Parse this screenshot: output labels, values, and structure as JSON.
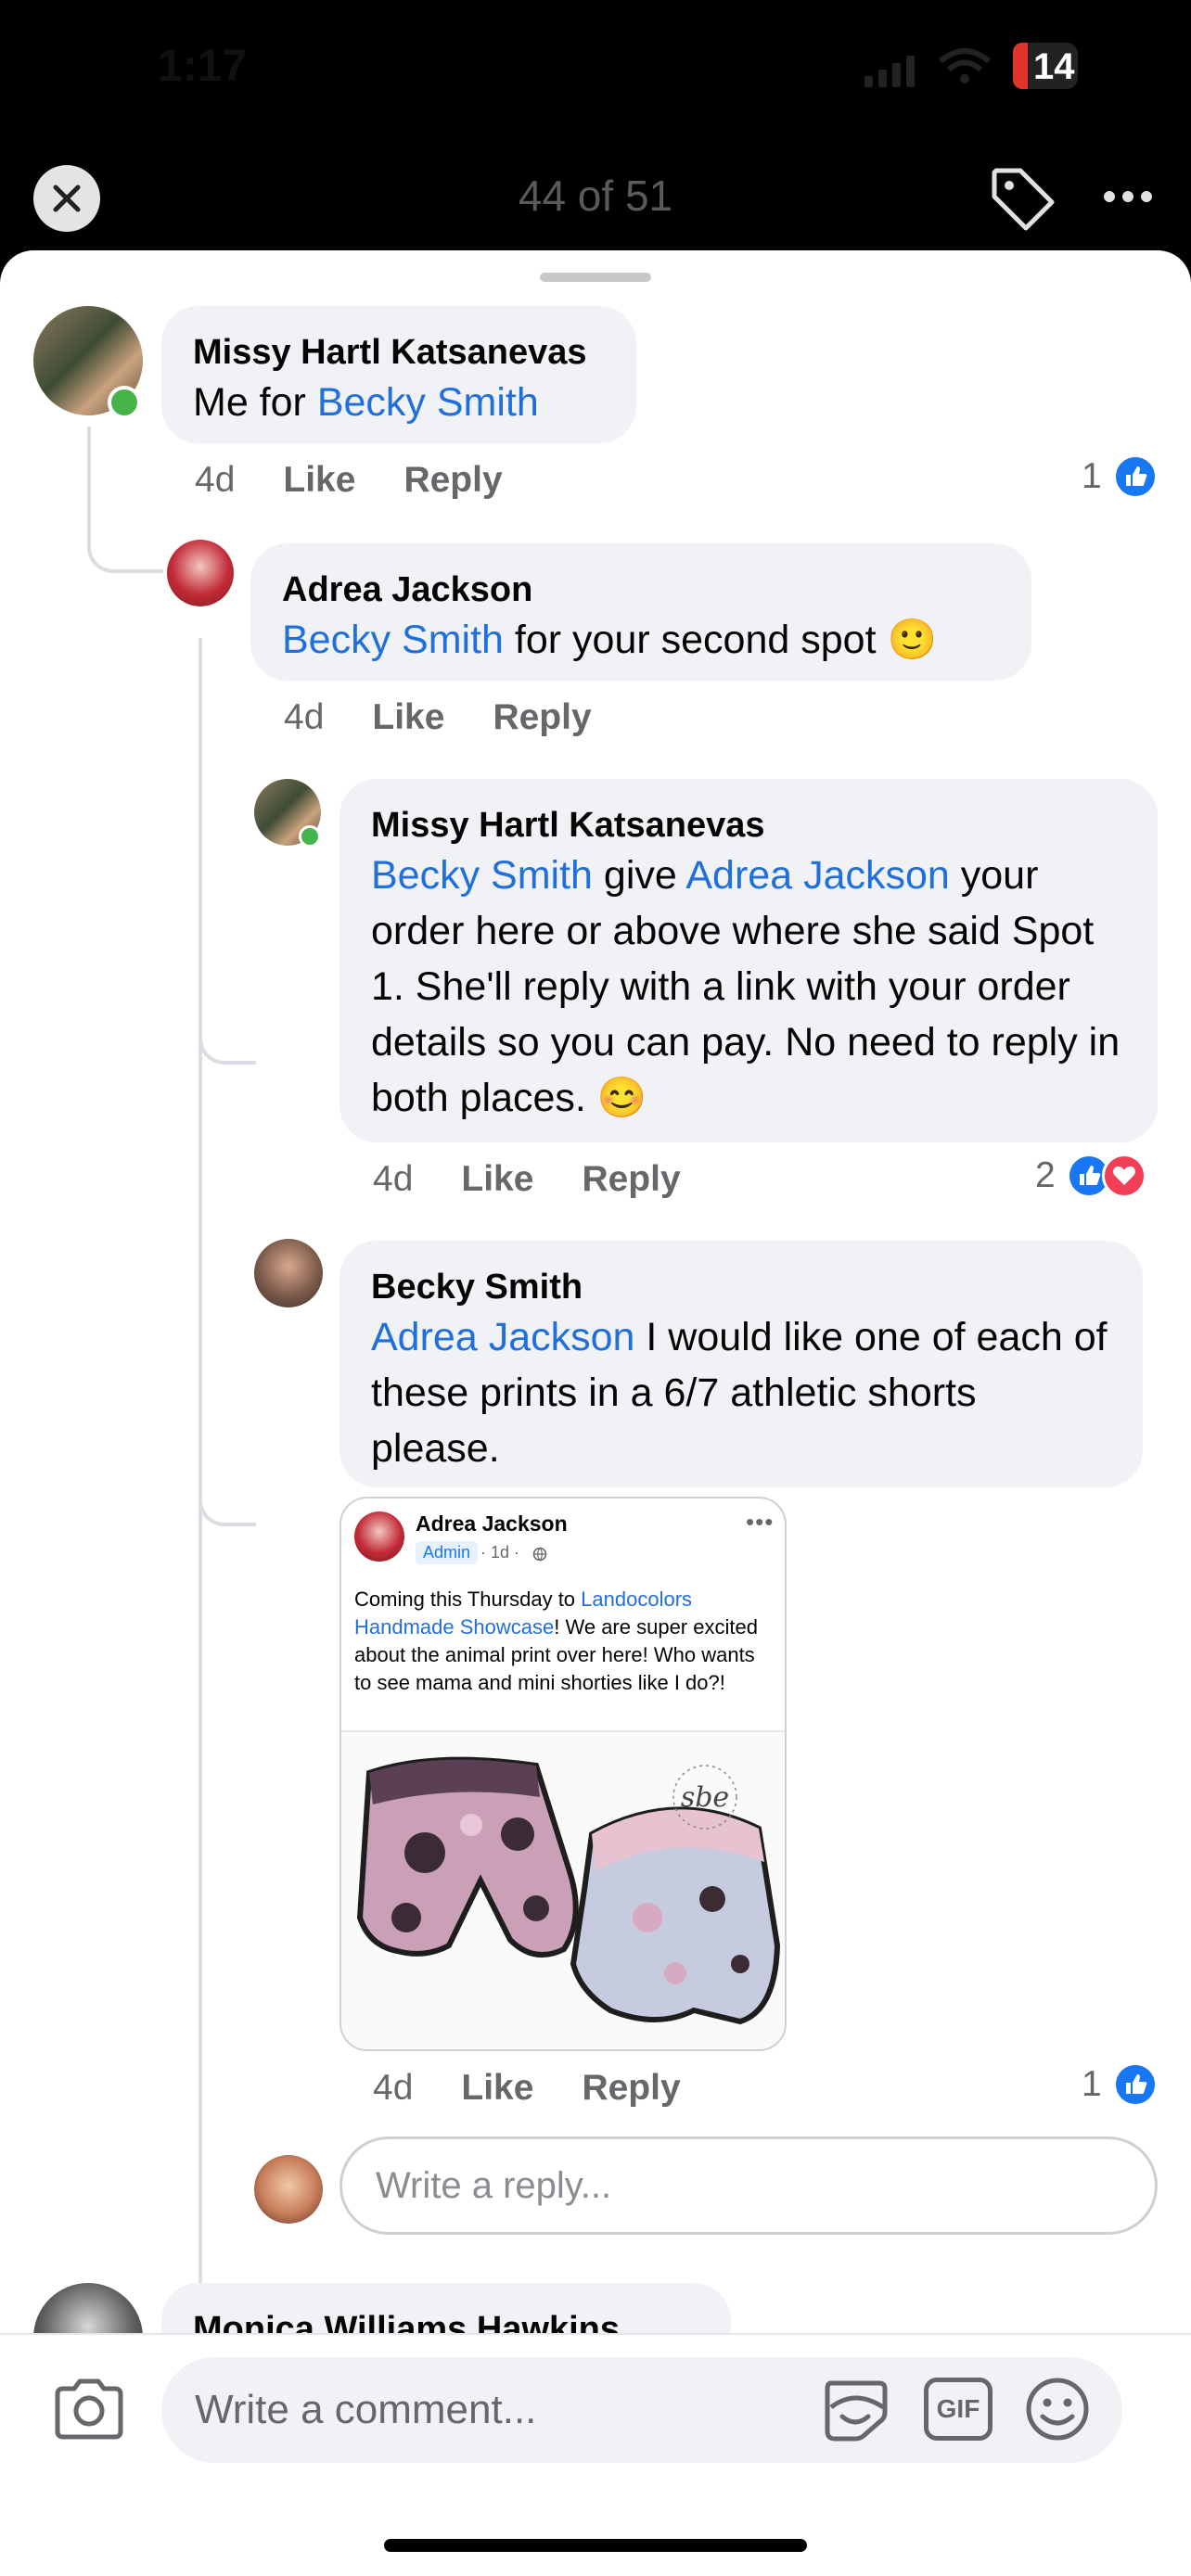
{
  "status_bar": {
    "time": "1:17",
    "battery": "14"
  },
  "top_bar": {
    "counter": "44 of 51"
  },
  "comments": [
    {
      "author": "Missy Hartl Katsanevas",
      "text_plain": "Me for ",
      "mention": "Becky Smith",
      "time": "4d",
      "like": "Like",
      "reply": "Reply",
      "reactions": "1"
    },
    {
      "author": "Adrea Jackson",
      "mention": "Becky Smith",
      "text_plain": " for your second spot 🙂",
      "time": "4d",
      "like": "Like",
      "reply": "Reply"
    },
    {
      "author": "Missy Hartl Katsanevas",
      "mention1": "Becky Smith",
      "mid": " give ",
      "mention2": "Adrea Jackson",
      "text_plain": " your order here or above where she said Spot 1.  She'll reply with a link with your order details so you can pay.  No need to reply in both places. 😊",
      "time": "4d",
      "like": "Like",
      "reply": "Reply",
      "reactions": "2"
    },
    {
      "author": "Becky Smith",
      "mention": "Adrea Jackson",
      "text_plain": " I would like one of each of these prints in a 6/7 athletic shorts please.",
      "time": "4d",
      "like": "Like",
      "reply": "Reply",
      "reactions": "1"
    }
  ],
  "shared_post": {
    "author": "Adrea Jackson",
    "badge": "Admin",
    "time": "· 1d ·",
    "text_before": "Coming this Thursday to ",
    "link": "Landocolors Handmade Showcase",
    "text_after": "! We are super excited about the animal print over here! Who wants to see mama and mini shorties like I do?!",
    "watermark": "sbe"
  },
  "reply_input": {
    "placeholder": "Write a reply..."
  },
  "next_comment": {
    "author": "Monica Williams Hawkins"
  },
  "comment_input": {
    "placeholder": "Write a comment..."
  },
  "icons": [
    "close-icon",
    "tag-icon",
    "more-icon",
    "like-icon",
    "love-icon",
    "camera-icon",
    "sticker-icon",
    "gif-icon",
    "emoji-icon"
  ],
  "colors": {
    "mention": "#216fdb",
    "like": "#1877f2",
    "love": "#f33e58",
    "bubble": "#f0f2f5",
    "online": "#44b44b"
  }
}
